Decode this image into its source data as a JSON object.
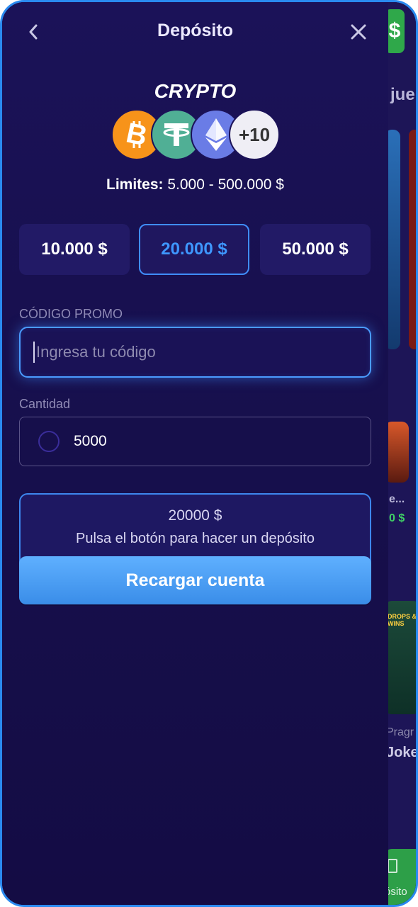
{
  "header": {
    "title": "Depósito",
    "back_icon": "chevron-left-icon",
    "close_icon": "close-icon"
  },
  "method": {
    "title": "CRYPTO",
    "coins": [
      "bitcoin-icon",
      "tether-icon",
      "ethereum-icon"
    ],
    "more_label": "+10",
    "limits_label": "Limites:",
    "limits_value": " 5.000 - 500.000 $"
  },
  "quick_amounts": [
    {
      "label": "10.000 $",
      "selected": false
    },
    {
      "label": "20.000 $",
      "selected": true
    },
    {
      "label": "50.000 $",
      "selected": false
    }
  ],
  "promo": {
    "label": "CÓDIGO PROMO",
    "placeholder": "Ingresa tu código",
    "value": ""
  },
  "quantity": {
    "label": "Cantidad",
    "value": "5000"
  },
  "summary": {
    "amount": "20000 $",
    "hint": "Pulsa el botón para hacer un depósito"
  },
  "submit": {
    "label": "Recargar cuenta"
  },
  "background": {
    "partial_texts": [
      "jue",
      "e...",
      "0 $",
      "Pragr",
      "Joke",
      "ósito",
      "DROPS & WINS"
    ]
  },
  "colors": {
    "panel_bg": "#1b1258",
    "accent_blue": "#3e97ff",
    "button_blue": "#4a9cf5",
    "green": "#2fa84a"
  }
}
